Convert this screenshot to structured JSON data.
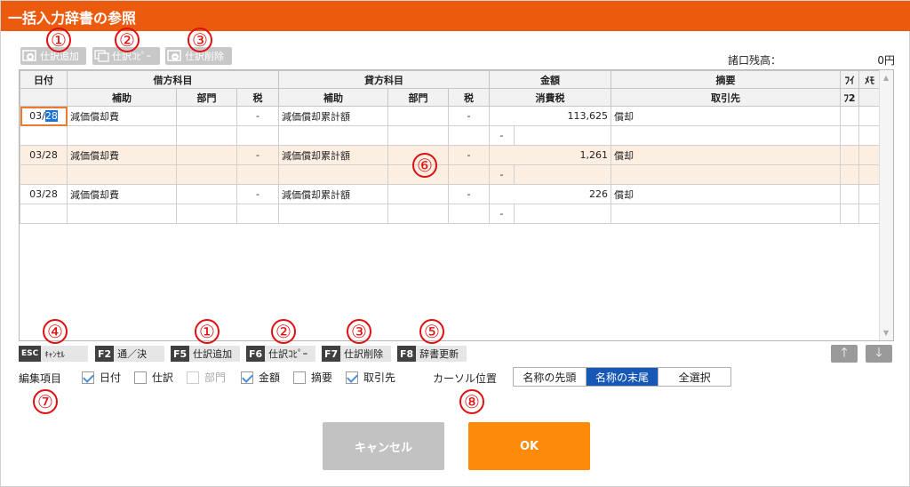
{
  "title": "一括入力辞書の参照",
  "toolbar": {
    "add_label": "仕訳追加",
    "copy_label": "仕訳ｺﾋﾟｰ",
    "delete_label": "仕訳削除"
  },
  "balance": {
    "label": "諸口残高：",
    "value": "0円"
  },
  "grid": {
    "header_top": [
      "日付",
      "借方科目",
      "貸方科目",
      "金額",
      "摘要",
      "ﾌｲ",
      "ﾒﾓ"
    ],
    "header_sub": [
      "補助",
      "部門",
      "税",
      "補助",
      "部門",
      "税",
      "消費税",
      "取引先",
      "ﾌ2"
    ],
    "rows": [
      {
        "date_prefix": "03/",
        "date_sel": "28",
        "debit": "減価償却費",
        "debit_tax": "-",
        "credit": "減価償却累計額",
        "credit_tax": "-",
        "amount": "113,625",
        "summary": "償却",
        "sub_dash": "-"
      },
      {
        "date": "03/28",
        "debit": "減価償却費",
        "debit_tax": "-",
        "credit": "減価償却累計額",
        "credit_tax": "-",
        "amount": "1,261",
        "summary": "償却",
        "sub_dash": "-"
      },
      {
        "date": "03/28",
        "debit": "減価償却費",
        "debit_tax": "-",
        "credit": "減価償却累計額",
        "credit_tax": "-",
        "amount": "226",
        "summary": "償却",
        "sub_dash": "-"
      }
    ]
  },
  "fkeys": [
    {
      "key": "ESC",
      "label": "ｷｬﾝｾﾙ"
    },
    {
      "key": "F2",
      "label": "通／決"
    },
    {
      "key": "F5",
      "label": "仕訳追加"
    },
    {
      "key": "F6",
      "label": "仕訳ｺﾋﾟｰ"
    },
    {
      "key": "F7",
      "label": "仕訳削除"
    },
    {
      "key": "F8",
      "label": "辞書更新"
    }
  ],
  "arrows": {
    "up": "🡑",
    "down": "🡓"
  },
  "edit_items": {
    "label": "編集項目",
    "options": [
      {
        "label": "日付",
        "checked": true,
        "disabled": false
      },
      {
        "label": "仕訳",
        "checked": false,
        "disabled": false
      },
      {
        "label": "部門",
        "checked": false,
        "disabled": true
      },
      {
        "label": "金額",
        "checked": true,
        "disabled": false
      },
      {
        "label": "摘要",
        "checked": false,
        "disabled": false
      },
      {
        "label": "取引先",
        "checked": true,
        "disabled": false
      }
    ]
  },
  "cursor_position": {
    "label": "カーソル位置",
    "options": [
      "名称の先頭",
      "名称の末尾",
      "全選択"
    ],
    "selected": "名称の末尾"
  },
  "buttons": {
    "cancel": "キャンセル",
    "ok": "OK"
  },
  "annotations": [
    "①",
    "②",
    "③",
    "④",
    "⑤",
    "⑥",
    "⑦",
    "⑧"
  ],
  "colors": {
    "title_bar": "#ec5a0d",
    "ok": "#fc8a0b",
    "cancel": "#c2c2c2",
    "annotation": "#e01010",
    "selected_segment": "#1757b5"
  }
}
